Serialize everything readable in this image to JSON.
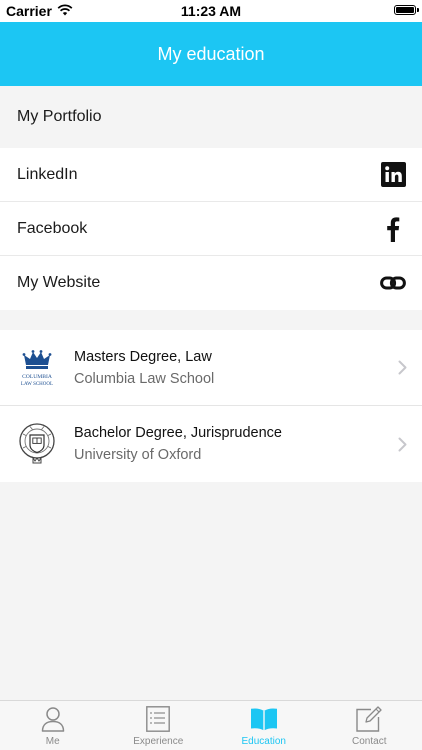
{
  "status_bar": {
    "carrier": "Carrier",
    "time": "11:23 AM"
  },
  "nav": {
    "title": "My education"
  },
  "portfolio": {
    "header": "My Portfolio",
    "links": [
      {
        "label": "LinkedIn",
        "icon": "linkedin-icon"
      },
      {
        "label": "Facebook",
        "icon": "facebook-icon"
      },
      {
        "label": "My Website",
        "icon": "link-icon"
      }
    ]
  },
  "education": [
    {
      "degree": "Masters Degree, Law",
      "school": "Columbia Law School",
      "logo": "columbia-law-logo",
      "logo_text": [
        "COLUMBIA",
        "LAW SCHOOL"
      ]
    },
    {
      "degree": "Bachelor Degree, Jurisprudence",
      "school": "University of Oxford",
      "logo": "oxford-seal-logo"
    }
  ],
  "tabs": [
    {
      "label": "Me",
      "icon": "person-icon",
      "active": false
    },
    {
      "label": "Experience",
      "icon": "list-icon",
      "active": false
    },
    {
      "label": "Education",
      "icon": "book-icon",
      "active": true
    },
    {
      "label": "Contact",
      "icon": "compose-icon",
      "active": false
    }
  ],
  "colors": {
    "accent": "#1cc6f3",
    "background": "#f4f4f4",
    "columbia_blue": "#1d4f91"
  }
}
